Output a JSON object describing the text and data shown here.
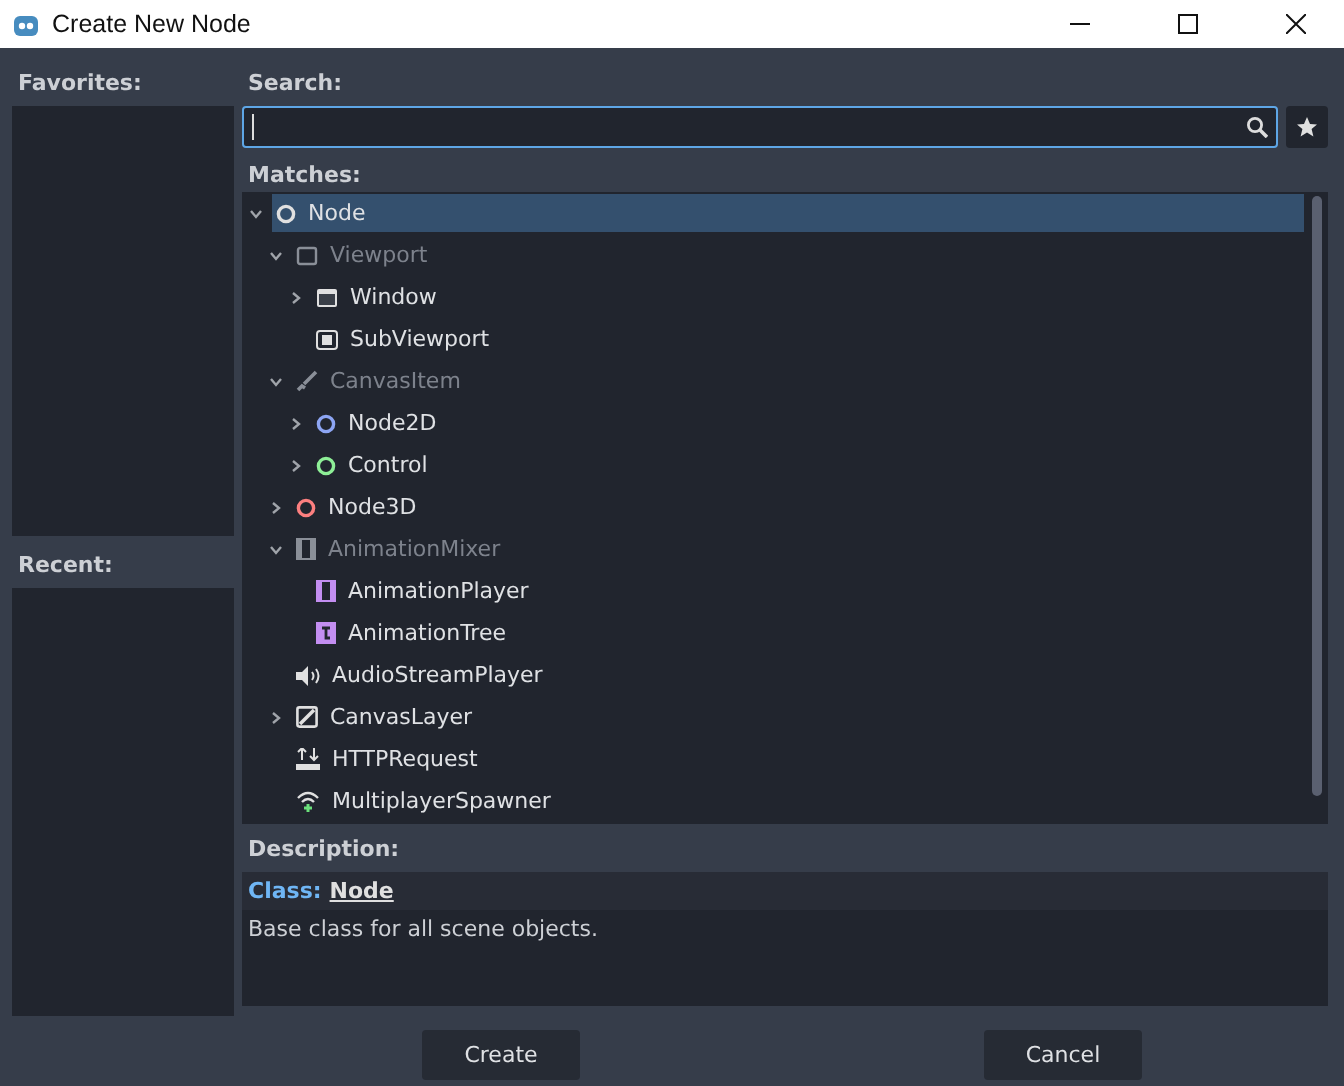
{
  "window": {
    "title": "Create New Node"
  },
  "favorites": {
    "label": "Favorites:"
  },
  "recent": {
    "label": "Recent:"
  },
  "search": {
    "label": "Search:"
  },
  "matches": {
    "label": "Matches:",
    "tree": [
      {
        "name": "Node",
        "kind": "ring",
        "color": "#e0e0e0",
        "selected": true,
        "dimmed": false,
        "expanded": true,
        "children": [
          {
            "name": "Viewport",
            "kind": "viewport",
            "selected": false,
            "dimmed": true,
            "expanded": true,
            "children": [
              {
                "name": "Window",
                "kind": "window",
                "selected": false,
                "dimmed": false,
                "expanded": false
              },
              {
                "name": "SubViewport",
                "kind": "subviewport",
                "selected": false,
                "dimmed": false
              }
            ]
          },
          {
            "name": "CanvasItem",
            "kind": "brush",
            "selected": false,
            "dimmed": true,
            "expanded": true,
            "children": [
              {
                "name": "Node2D",
                "kind": "ring",
                "color": "#8da5f3",
                "selected": false,
                "dimmed": false,
                "expanded": false
              },
              {
                "name": "Control",
                "kind": "ring",
                "color": "#8eef97",
                "selected": false,
                "dimmed": false,
                "expanded": false
              }
            ]
          },
          {
            "name": "Node3D",
            "kind": "ring",
            "color": "#fc7f7f",
            "selected": false,
            "dimmed": false,
            "expanded": false
          },
          {
            "name": "AnimationMixer",
            "kind": "film",
            "selected": false,
            "dimmed": true,
            "expanded": true,
            "children": [
              {
                "name": "AnimationPlayer",
                "kind": "film-purple",
                "selected": false,
                "dimmed": false
              },
              {
                "name": "AnimationTree",
                "kind": "tree-purple",
                "selected": false,
                "dimmed": false
              }
            ]
          },
          {
            "name": "AudioStreamPlayer",
            "kind": "speaker",
            "selected": false,
            "dimmed": false
          },
          {
            "name": "CanvasLayer",
            "kind": "layer",
            "selected": false,
            "dimmed": false,
            "expanded": false
          },
          {
            "name": "HTTPRequest",
            "kind": "http",
            "selected": false,
            "dimmed": false
          },
          {
            "name": "MultiplayerSpawner",
            "kind": "wifi",
            "selected": false,
            "dimmed": false
          }
        ]
      }
    ]
  },
  "description": {
    "label": "Description:",
    "class_label": "Class:",
    "class_name": "Node",
    "text": "Base class for all scene objects."
  },
  "buttons": [
    {
      "label": "Create"
    },
    {
      "label": "Cancel"
    }
  ]
}
